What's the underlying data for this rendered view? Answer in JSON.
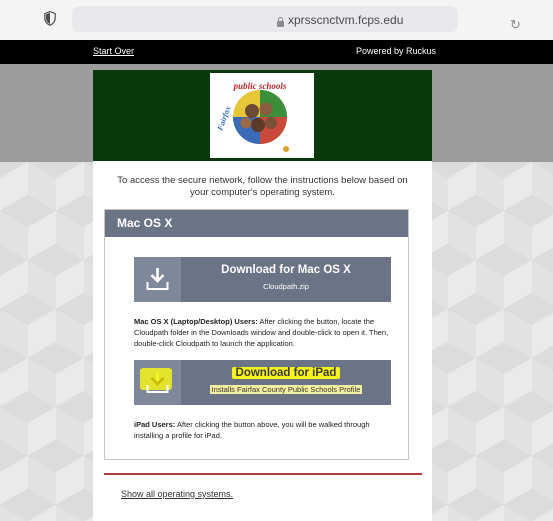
{
  "browser": {
    "url": "xprsscnctvm.fcps.edu",
    "icons": {
      "shield": "shield-icon",
      "lock": "lock-icon",
      "reload": "reload-icon"
    }
  },
  "topbar": {
    "start_over": "Start Over",
    "powered_by": "Powered by Ruckus"
  },
  "header": {
    "logo_text": "Fairfax County Public Schools",
    "colors": {
      "band": "#0a3a0c"
    }
  },
  "intro": {
    "text": "To access the secure network, follow the instructions below based on your computer's operating system."
  },
  "os_section": {
    "title": "Mac OS X",
    "mac_button": {
      "title": "Download for Mac OS X",
      "subtitle": "Cloudpath.zip",
      "icon": "download-icon"
    },
    "mac_desc_bold": "Mac OS X (Laptop/Desktop) Users:",
    "mac_desc": " After clicking the button, locate the Cloudpath folder in the Downloads window and double-click to open it. Then, double-click Cloudpath to launch the application.",
    "ipad_button": {
      "title": "Download for iPad",
      "subtitle": "Installs Fairfax County Public Schools Profile",
      "icon": "download-icon",
      "highlight_color": "#f5f31b"
    },
    "ipad_desc_bold": "iPad Users:",
    "ipad_desc": " After clicking the button above, you will be walked through installing a profile for iPad."
  },
  "footer": {
    "show_all": "Show all operating systems."
  },
  "colors": {
    "button": "#6b7386",
    "divider": "#b23a3a",
    "topbar": "#000000"
  }
}
